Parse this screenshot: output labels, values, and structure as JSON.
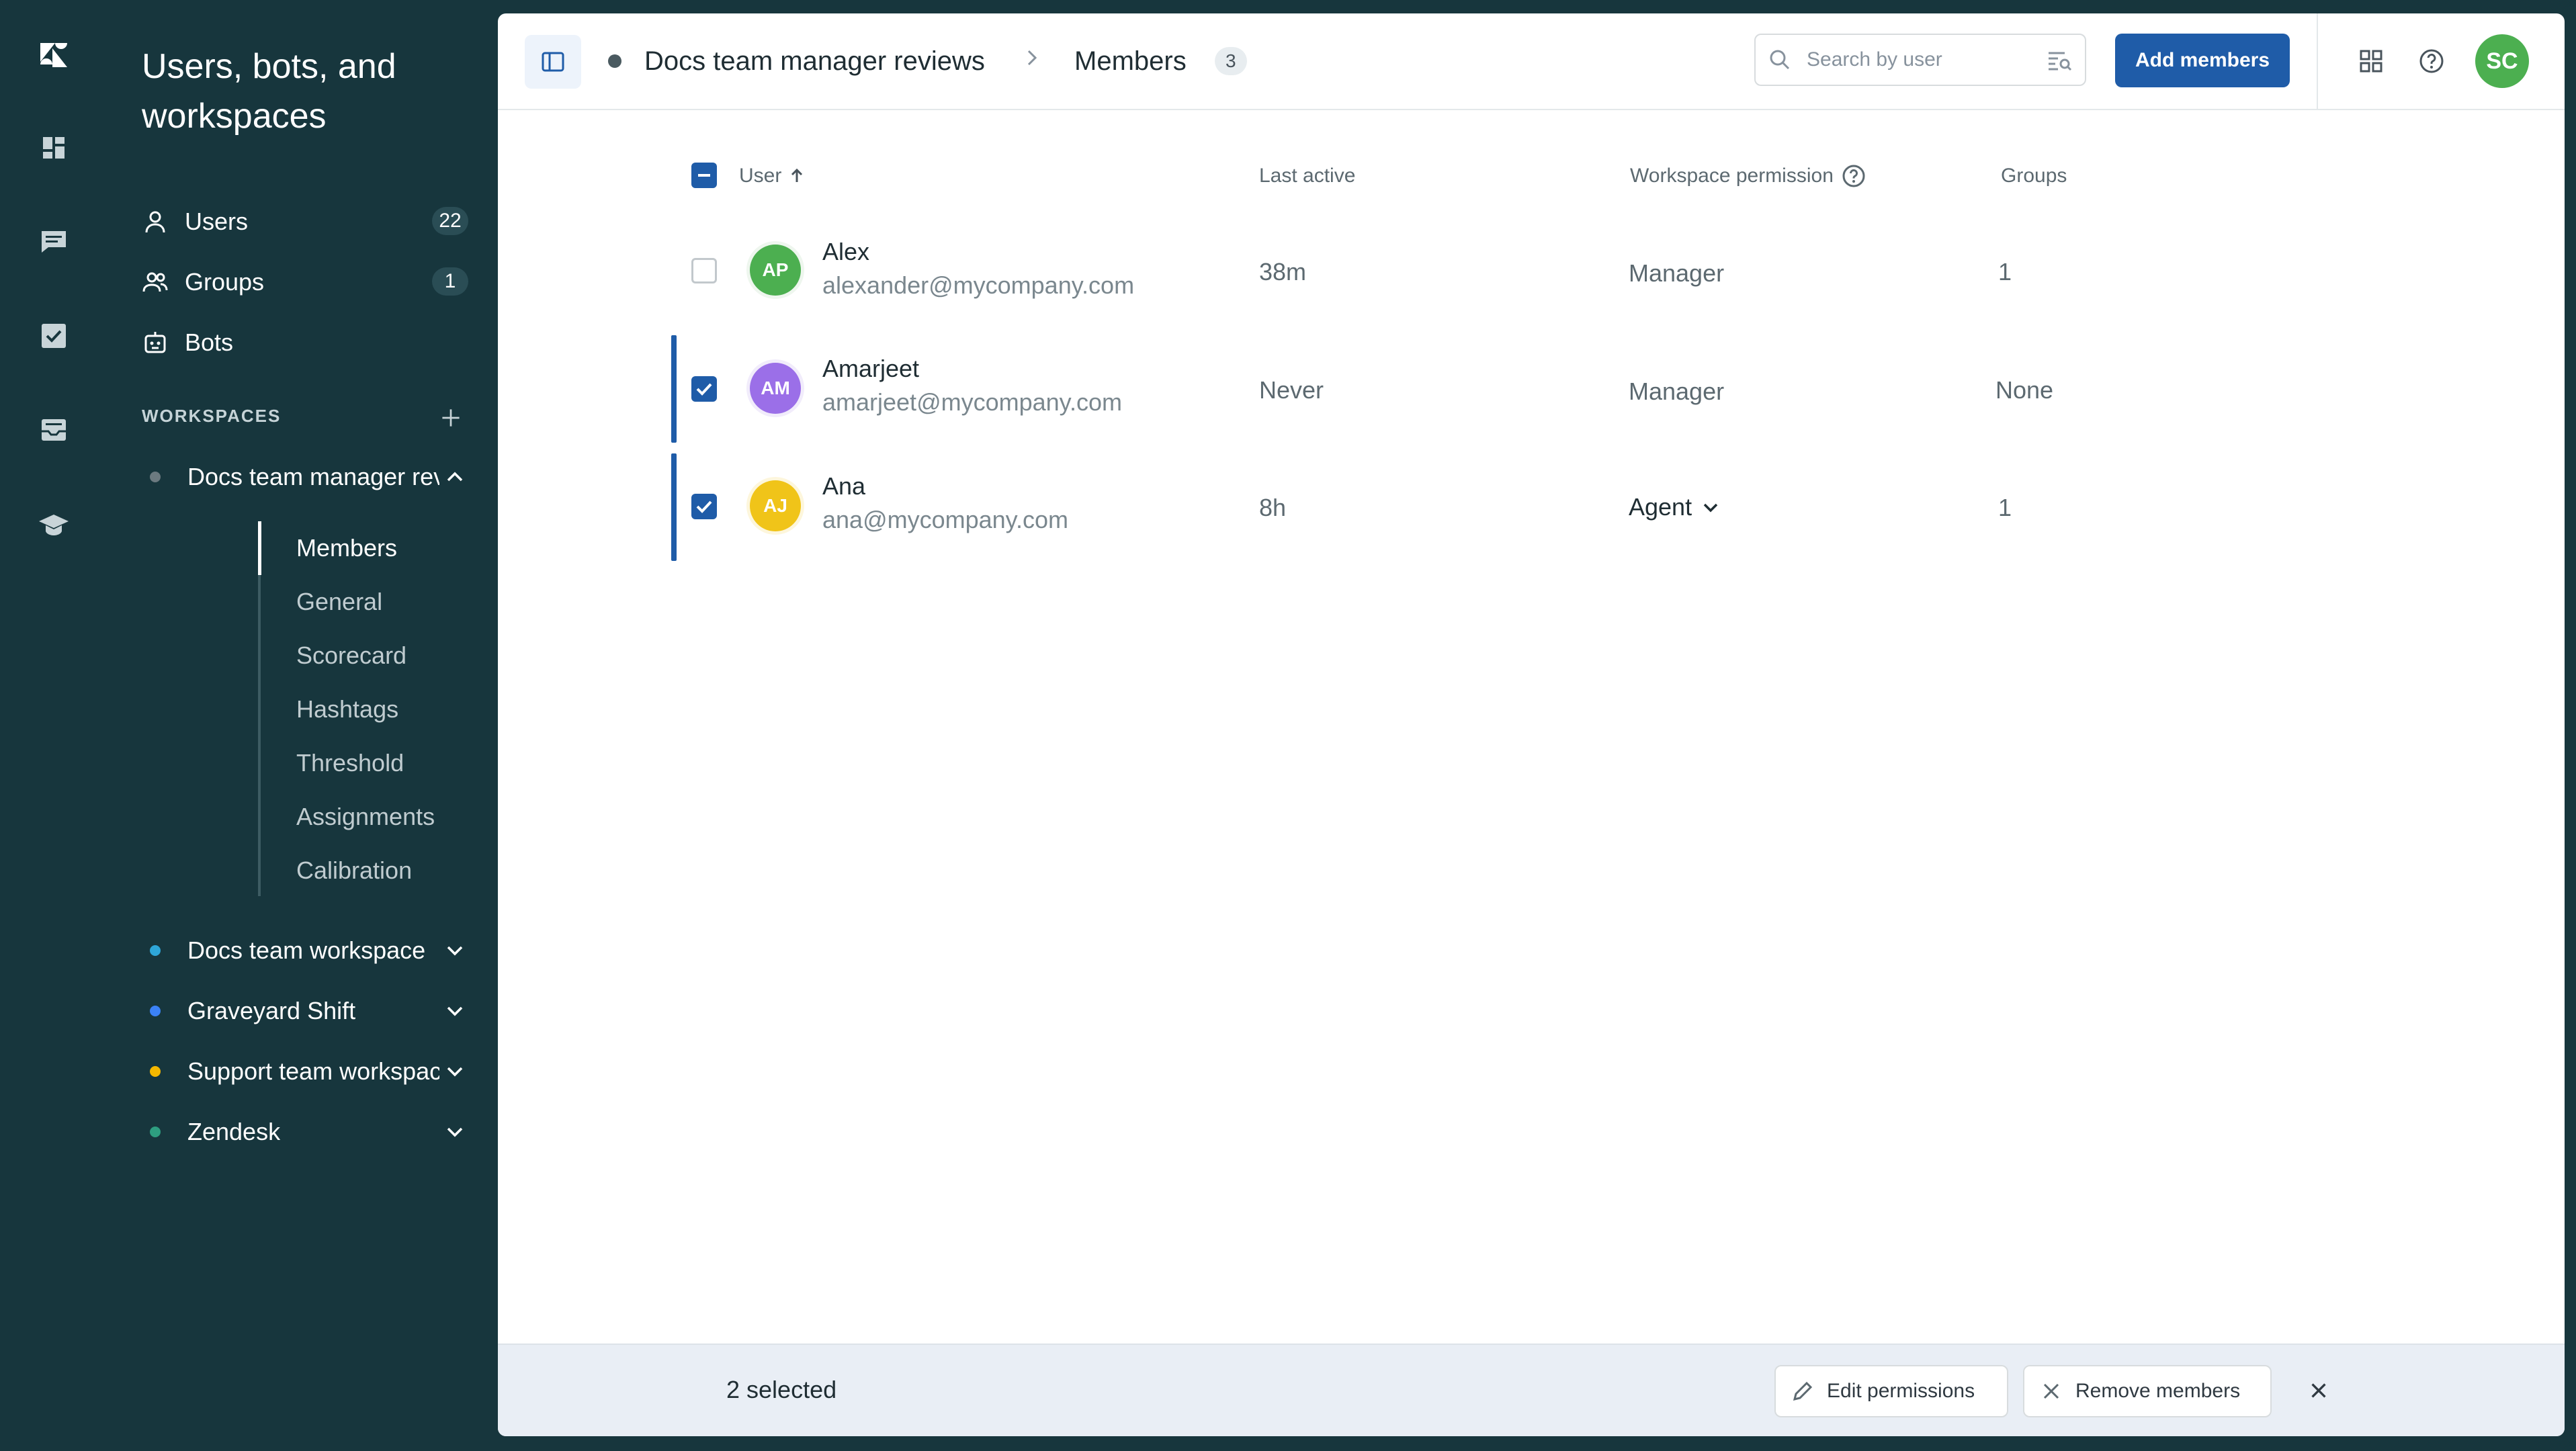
{
  "rail": {
    "items": [
      "zendesk-logo",
      "dashboard-icon",
      "conversations-icon",
      "tasks-icon",
      "inbox-icon",
      "training-icon"
    ]
  },
  "sidebar": {
    "title": "Users, bots, and workspaces",
    "nav": [
      {
        "label": "Users",
        "count": "22",
        "icon": "person-icon"
      },
      {
        "label": "Groups",
        "count": "1",
        "icon": "group-icon"
      },
      {
        "label": "Bots",
        "count": "",
        "icon": "bot-icon"
      }
    ],
    "workspaces_heading": "WORKSPACES",
    "workspaces": [
      {
        "label": "Docs team manager reviews",
        "dot_color": "#6c7a80",
        "expanded": true
      },
      {
        "label": "Docs team workspace",
        "dot_color": "#2ea6d8",
        "expanded": false
      },
      {
        "label": "Graveyard Shift",
        "dot_color": "#3b82f6",
        "expanded": false
      },
      {
        "label": "Support team workspace",
        "dot_color": "#f5b800",
        "expanded": false
      },
      {
        "label": "Zendesk",
        "dot_color": "#2e9e80",
        "expanded": false
      }
    ],
    "subnav": [
      "Members",
      "General",
      "Scorecard",
      "Hashtags",
      "Threshold",
      "Assignments",
      "Calibration"
    ],
    "subnav_active": "Members"
  },
  "header": {
    "workspace": "Docs team manager reviews",
    "current": "Members",
    "count": "3",
    "search_placeholder": "Search by user",
    "add_button": "Add members",
    "user_initials": "SC"
  },
  "table": {
    "columns": {
      "user": "User",
      "last_active": "Last active",
      "permission": "Workspace permission",
      "groups": "Groups"
    },
    "rows": [
      {
        "initials": "AP",
        "avatar_color": "#4caf50",
        "name": "Alex",
        "email": "alexander@mycompany.com",
        "last_active": "38m",
        "permission": "Manager",
        "groups": "1",
        "checked": false
      },
      {
        "initials": "AM",
        "avatar_color": "#9b6fe8",
        "name": "Amarjeet",
        "email": "amarjeet@mycompany.com",
        "last_active": "Never",
        "permission": "Manager",
        "groups": "None",
        "checked": true
      },
      {
        "initials": "AJ",
        "avatar_color": "#f0c419",
        "name": "Ana",
        "email": "ana@mycompany.com",
        "last_active": "8h",
        "permission": "Agent",
        "groups": "1",
        "checked": true
      }
    ]
  },
  "bottom": {
    "selected_text": "2 selected",
    "edit_label": "Edit permissions",
    "remove_label": "Remove members"
  },
  "colors": {
    "accent": "#1f5ca8",
    "sidebar_bg": "#17363d"
  }
}
